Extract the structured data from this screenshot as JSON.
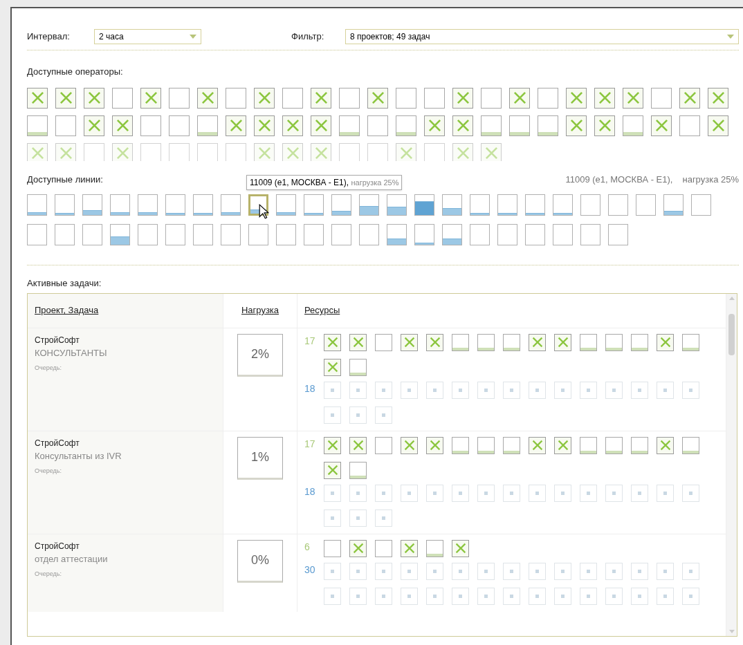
{
  "interval": {
    "label": "Интервал:",
    "value": "2 часа"
  },
  "filter": {
    "label": "Фильтр:",
    "value": "8 проектов; 49 задач"
  },
  "operators": {
    "title": "Доступные операторы:",
    "rows": [
      {
        "faded": false,
        "boxes": [
          {
            "checked": true,
            "busy": false
          },
          {
            "checked": true,
            "busy": false
          },
          {
            "checked": true,
            "busy": false
          },
          {
            "checked": false,
            "busy": false
          },
          {
            "checked": true,
            "busy": false
          },
          {
            "checked": false,
            "busy": false
          },
          {
            "checked": true,
            "busy": false
          },
          {
            "checked": false,
            "busy": false
          },
          {
            "checked": true,
            "busy": false
          },
          {
            "checked": false,
            "busy": false
          },
          {
            "checked": true,
            "busy": false
          },
          {
            "checked": false,
            "busy": false
          },
          {
            "checked": true,
            "busy": false
          },
          {
            "checked": false,
            "busy": false
          },
          {
            "checked": false,
            "busy": false
          },
          {
            "checked": true,
            "busy": false
          },
          {
            "checked": false,
            "busy": false
          },
          {
            "checked": true,
            "busy": false
          },
          {
            "checked": false,
            "busy": false
          },
          {
            "checked": true,
            "busy": false
          },
          {
            "checked": true,
            "busy": false
          },
          {
            "checked": true,
            "busy": false
          },
          {
            "checked": false,
            "busy": false
          },
          {
            "checked": true,
            "busy": false
          },
          {
            "checked": true,
            "busy": false
          }
        ]
      },
      {
        "faded": false,
        "boxes": [
          {
            "checked": false,
            "busy": true
          },
          {
            "checked": false,
            "busy": false
          },
          {
            "checked": true,
            "busy": false
          },
          {
            "checked": true,
            "busy": false
          },
          {
            "checked": false,
            "busy": false
          },
          {
            "checked": false,
            "busy": false
          },
          {
            "checked": false,
            "busy": true
          },
          {
            "checked": true,
            "busy": false
          },
          {
            "checked": true,
            "busy": false
          },
          {
            "checked": true,
            "busy": false
          },
          {
            "checked": true,
            "busy": false
          },
          {
            "checked": false,
            "busy": true
          },
          {
            "checked": false,
            "busy": false
          },
          {
            "checked": false,
            "busy": true
          },
          {
            "checked": true,
            "busy": false
          },
          {
            "checked": true,
            "busy": false
          },
          {
            "checked": false,
            "busy": true
          },
          {
            "checked": false,
            "busy": true
          },
          {
            "checked": false,
            "busy": true
          },
          {
            "checked": true,
            "busy": false
          },
          {
            "checked": true,
            "busy": false
          },
          {
            "checked": false,
            "busy": true
          },
          {
            "checked": true,
            "busy": false
          },
          {
            "checked": false,
            "busy": false
          },
          {
            "checked": true,
            "busy": false
          }
        ]
      },
      {
        "faded": true,
        "boxes": [
          {
            "checked": true,
            "busy": false
          },
          {
            "checked": true,
            "busy": false
          },
          {
            "checked": false,
            "busy": false
          },
          {
            "checked": true,
            "busy": false
          },
          {
            "checked": false,
            "busy": false
          },
          {
            "checked": false,
            "busy": false
          },
          {
            "checked": false,
            "busy": false
          },
          {
            "checked": false,
            "busy": false
          },
          {
            "checked": true,
            "busy": false
          },
          {
            "checked": true,
            "busy": false
          },
          {
            "checked": true,
            "busy": false
          },
          {
            "checked": false,
            "busy": false
          },
          {
            "checked": false,
            "busy": false
          },
          {
            "checked": true,
            "busy": false
          },
          {
            "checked": false,
            "busy": false
          },
          {
            "checked": true,
            "busy": false
          },
          {
            "checked": true,
            "busy": false
          }
        ]
      }
    ]
  },
  "lines": {
    "title": "Доступные линии:",
    "status": {
      "name": "11009 (e1, МОСКВА - E1),",
      "load": "нагрузка 25%"
    },
    "tooltip": {
      "name": "11009 (e1, МОСКВА - E1),",
      "load": "нагрузка 25%"
    },
    "rows": [
      [
        {
          "level": 0.15,
          "selected": false
        },
        {
          "level": 0.1,
          "selected": false
        },
        {
          "level": 0.25,
          "selected": false
        },
        {
          "level": 0.15,
          "selected": false
        },
        {
          "level": 0.15,
          "selected": false
        },
        {
          "level": 0.1,
          "selected": false
        },
        {
          "level": 0.1,
          "selected": false
        },
        {
          "level": 0.15,
          "selected": false
        },
        {
          "level": 0.25,
          "selected": true
        },
        {
          "level": 0.15,
          "selected": false
        },
        {
          "level": 0.1,
          "selected": false
        },
        {
          "level": 0.2,
          "selected": false
        },
        {
          "level": 0.45,
          "selected": false
        },
        {
          "level": 0.4,
          "selected": false
        },
        {
          "level": 0.7,
          "selected": false
        },
        {
          "level": 0.35,
          "selected": false
        },
        {
          "level": 0.1,
          "selected": false
        },
        {
          "level": 0.1,
          "selected": false
        },
        {
          "level": 0.1,
          "selected": false
        },
        {
          "level": 0.1,
          "selected": false
        },
        {
          "selected": false
        },
        {
          "selected": false
        },
        {
          "selected": false
        },
        {
          "level": 0.2,
          "selected": false
        },
        {
          "selected": false
        }
      ],
      [
        {
          "selected": false
        },
        {
          "selected": false
        },
        {
          "selected": false
        },
        {
          "level": 0.4,
          "selected": false
        },
        {
          "selected": false
        },
        {
          "selected": false
        },
        {
          "selected": false
        },
        {
          "selected": false
        },
        {
          "selected": false
        },
        {
          "selected": false
        },
        {
          "selected": false
        },
        {
          "selected": false
        },
        {
          "selected": false
        },
        {
          "level": 0.3,
          "selected": false
        },
        {
          "level": 0.1,
          "selected": false
        },
        {
          "level": 0.3,
          "selected": false
        },
        {
          "selected": false
        },
        {
          "selected": false
        },
        {
          "selected": false
        },
        {
          "selected": false
        },
        {
          "selected": false
        },
        {
          "selected": false
        }
      ]
    ]
  },
  "tasks": {
    "title": "Активные задачи:",
    "columns": [
      "Проект, Задача",
      "Нагрузка",
      "Ресурсы"
    ],
    "rows": [
      {
        "project": "СтройСофт",
        "task": "КОНСУЛЬТАНТЫ",
        "queue": "Очередь:",
        "load": "2%",
        "groups": [
          {
            "kind": "operators",
            "label": "17",
            "boxes": [
              {
                "checked": true,
                "busy": false
              },
              {
                "checked": true,
                "busy": false
              },
              {
                "checked": false,
                "busy": false
              },
              {
                "checked": true,
                "busy": false
              },
              {
                "checked": true,
                "busy": false
              },
              {
                "checked": false,
                "busy": true
              },
              {
                "checked": false,
                "busy": true
              },
              {
                "checked": false,
                "busy": true
              },
              {
                "checked": true,
                "busy": false
              },
              {
                "checked": true,
                "busy": false
              },
              {
                "checked": false,
                "busy": true
              },
              {
                "checked": false,
                "busy": true
              },
              {
                "checked": false,
                "busy": true
              },
              {
                "checked": true,
                "busy": false
              },
              {
                "checked": false,
                "busy": true
              },
              {
                "checked": true,
                "busy": false
              },
              {
                "checked": false,
                "busy": true
              }
            ]
          },
          {
            "kind": "lines",
            "label": "18",
            "boxes": [
              {
                "busy": false
              },
              {
                "busy": false
              },
              {
                "busy": false
              },
              {
                "busy": false
              },
              {
                "busy": false
              },
              {
                "busy": false
              },
              {
                "busy": false
              },
              {
                "busy": false
              },
              {
                "busy": false
              },
              {
                "busy": false
              },
              {
                "busy": false
              },
              {
                "busy": false
              },
              {
                "busy": false
              },
              {
                "busy": false
              },
              {
                "busy": false
              },
              {
                "busy": false
              },
              {
                "busy": false
              },
              {
                "busy": false
              }
            ]
          }
        ]
      },
      {
        "project": "СтройСофт",
        "task": "Консультанты из IVR",
        "queue": "Очередь:",
        "load": "1%",
        "groups": [
          {
            "kind": "operators",
            "label": "17",
            "boxes": [
              {
                "checked": true,
                "busy": false
              },
              {
                "checked": true,
                "busy": false
              },
              {
                "checked": false,
                "busy": false
              },
              {
                "checked": true,
                "busy": false
              },
              {
                "checked": true,
                "busy": false
              },
              {
                "checked": false,
                "busy": true
              },
              {
                "checked": false,
                "busy": true
              },
              {
                "checked": false,
                "busy": true
              },
              {
                "checked": true,
                "busy": false
              },
              {
                "checked": true,
                "busy": false
              },
              {
                "checked": false,
                "busy": true
              },
              {
                "checked": false,
                "busy": true
              },
              {
                "checked": false,
                "busy": true
              },
              {
                "checked": true,
                "busy": false
              },
              {
                "checked": false,
                "busy": true
              },
              {
                "checked": true,
                "busy": false
              },
              {
                "checked": false,
                "busy": true
              }
            ]
          },
          {
            "kind": "lines",
            "label": "18",
            "boxes": [
              {
                "busy": false
              },
              {
                "busy": false
              },
              {
                "busy": false
              },
              {
                "busy": false
              },
              {
                "busy": false
              },
              {
                "busy": false
              },
              {
                "busy": false
              },
              {
                "busy": false
              },
              {
                "busy": false
              },
              {
                "busy": false
              },
              {
                "busy": false
              },
              {
                "busy": false
              },
              {
                "busy": false
              },
              {
                "busy": false
              },
              {
                "busy": false
              },
              {
                "busy": false
              },
              {
                "busy": false
              },
              {
                "busy": false
              }
            ]
          }
        ]
      },
      {
        "project": "СтройСофт",
        "task": "отдел аттестации",
        "queue": "Очередь:",
        "load": "0%",
        "groups": [
          {
            "kind": "operators",
            "label": "6",
            "boxes": [
              {
                "checked": false,
                "busy": false
              },
              {
                "checked": true,
                "busy": false
              },
              {
                "checked": false,
                "busy": false
              },
              {
                "checked": true,
                "busy": false
              },
              {
                "checked": false,
                "busy": true
              },
              {
                "checked": true,
                "busy": false
              }
            ]
          },
          {
            "kind": "lines",
            "label": "30",
            "boxes": [
              {
                "busy": false
              },
              {
                "busy": false
              },
              {
                "busy": false
              },
              {
                "busy": false
              },
              {
                "busy": false
              },
              {
                "busy": false
              },
              {
                "busy": false
              },
              {
                "busy": false
              },
              {
                "busy": false
              },
              {
                "busy": false
              },
              {
                "busy": false
              },
              {
                "busy": false
              },
              {
                "busy": false
              },
              {
                "busy": false
              },
              {
                "busy": false
              },
              {
                "busy": false
              },
              {
                "busy": false
              },
              {
                "busy": false
              },
              {
                "busy": false
              },
              {
                "busy": false
              },
              {
                "busy": false
              },
              {
                "busy": false
              },
              {
                "busy": false
              },
              {
                "busy": false
              },
              {
                "busy": false
              },
              {
                "busy": false
              },
              {
                "busy": false
              },
              {
                "busy": false
              },
              {
                "busy": false
              },
              {
                "busy": false
              }
            ]
          }
        ]
      }
    ]
  }
}
